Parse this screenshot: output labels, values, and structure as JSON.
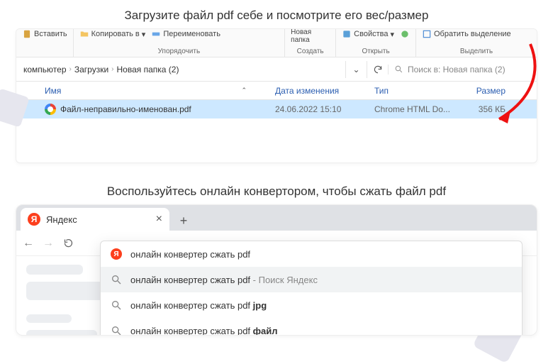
{
  "heading1": "Загрузите файл pdf себе и посмотрите его вес/размер",
  "heading2": "Воспользуйтесь онлайн конвертором, чтобы сжать файл pdf",
  "ribbon": {
    "paste_fragment": "Вставить",
    "copy_to": "Копировать в",
    "rename": "Переименовать",
    "new_folder": "Новая\nпапка",
    "properties": "Свойства",
    "invert_sel": "Обратить выделение",
    "group_organize": "Упорядочить",
    "group_create": "Создать",
    "group_open": "Открыть",
    "group_select": "Выделить"
  },
  "breadcrumbs": [
    "компьютер",
    "Загрузки",
    "Новая папка (2)"
  ],
  "search_placeholder": "Поиск в: Новая папка (2)",
  "columns": {
    "name": "Имя",
    "date": "Дата изменения",
    "type": "Тип",
    "size": "Размер"
  },
  "file": {
    "name": "Файл-неправильно-именован.pdf",
    "date": "24.06.2022 15:10",
    "type": "Chrome HTML Do...",
    "size": "356 КБ"
  },
  "browser": {
    "tab_title": "Яндекс",
    "y_letter": "Я",
    "suggestions": [
      {
        "text": "онлайн конвертер сжать pdf",
        "bold": "",
        "trailing": "",
        "icon": "y"
      },
      {
        "text": "онлайн конвертер сжать pdf",
        "bold": "",
        "trailing": " - Поиск Яндекс",
        "icon": "search",
        "hi": true
      },
      {
        "text": "онлайн конвертер сжать pdf ",
        "bold": "jpg",
        "trailing": "",
        "icon": "search"
      },
      {
        "text": "онлайн конвертер сжать pdf ",
        "bold": "файл",
        "trailing": "",
        "icon": "search"
      }
    ]
  }
}
